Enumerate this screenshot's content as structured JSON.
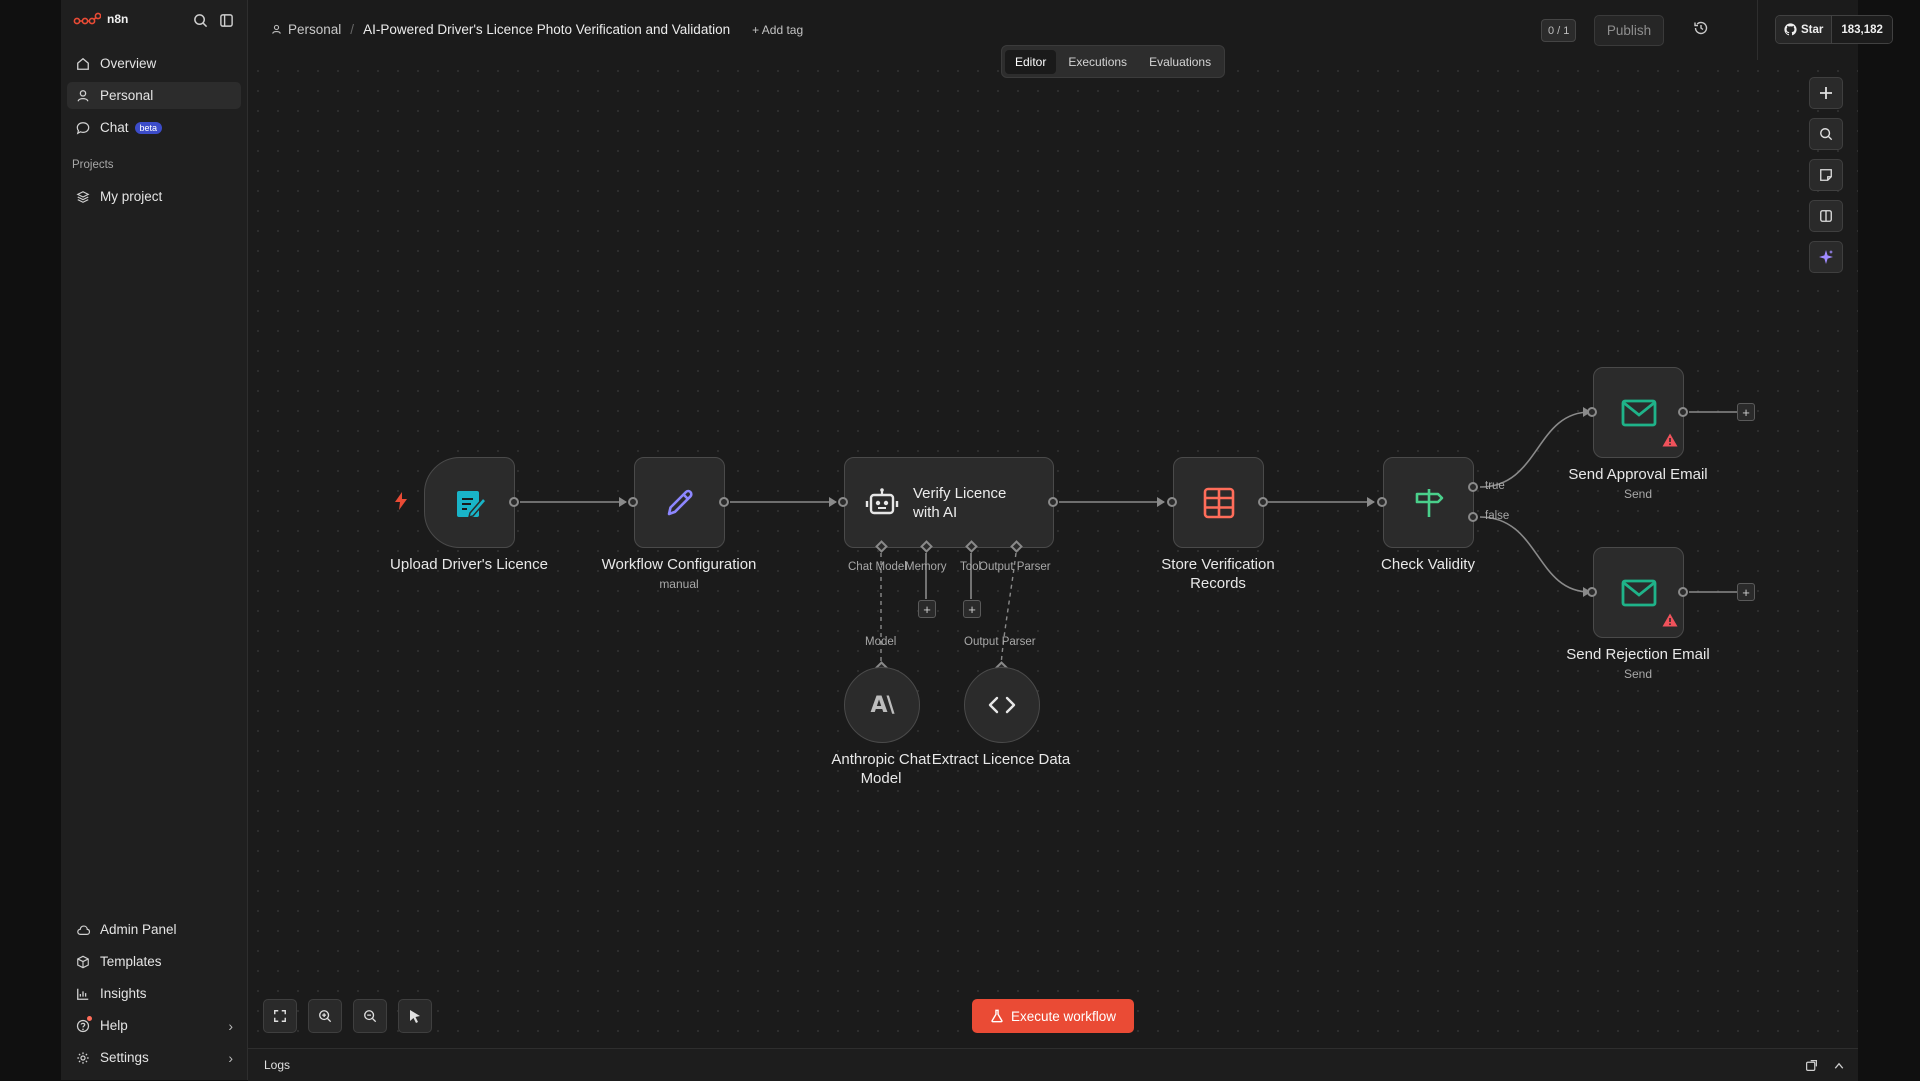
{
  "app": {
    "name": "n8n"
  },
  "sidebar": {
    "items": [
      {
        "label": "Overview",
        "icon": "home-icon"
      },
      {
        "label": "Personal",
        "icon": "user-icon"
      },
      {
        "label": "Chat",
        "icon": "chat-icon",
        "badge": "beta"
      }
    ],
    "projects_label": "Projects",
    "projects": [
      {
        "label": "My project",
        "icon": "layers-icon"
      }
    ],
    "bottom_items": [
      {
        "label": "Admin Panel",
        "icon": "cloud-icon"
      },
      {
        "label": "Templates",
        "icon": "box-icon"
      },
      {
        "label": "Insights",
        "icon": "chart-icon"
      },
      {
        "label": "Help",
        "icon": "help-icon"
      },
      {
        "label": "Settings",
        "icon": "gear-icon"
      }
    ]
  },
  "header": {
    "breadcrumb_project": "Personal",
    "breadcrumb_sep": "/",
    "workflow_name": "AI-Powered Driver's Licence Photo Verification and Validation",
    "add_tag": "+ Add tag",
    "counter": "0 / 1",
    "publish": "Publish",
    "github_star": "Star",
    "github_count": "183,182",
    "tabs": [
      "Editor",
      "Executions",
      "Evaluations"
    ]
  },
  "nodes": {
    "upload": {
      "label": "Upload Driver's Licence"
    },
    "config": {
      "label": "Workflow Configuration",
      "sub": "manual"
    },
    "verify": {
      "label_line1": "Verify Licence",
      "label_line2": "with AI"
    },
    "store": {
      "label_line1": "Store Verification",
      "label_line2": "Records"
    },
    "check": {
      "label": "Check Validity"
    },
    "approval": {
      "label": "Send Approval Email",
      "sub": "Send"
    },
    "rejection": {
      "label": "Send Rejection Email",
      "sub": "Send"
    },
    "anthropic": {
      "label_line1": "Anthropic Chat",
      "label_line2": "Model"
    },
    "extract": {
      "label": "Extract Licence Data"
    }
  },
  "sub_ports": {
    "chat_model": "Chat Model",
    "memory": "Memory",
    "tool": "Tool",
    "output_parser": "Output Parser",
    "model": "Model",
    "output_parser_2": "Output Parser"
  },
  "branches": {
    "true": "true",
    "false": "false"
  },
  "canvas": {
    "execute_button": "Execute workflow"
  },
  "logs": {
    "label": "Logs"
  },
  "colors": {
    "accent": "#ea4b35",
    "email": "#1fb389",
    "form": "#19b4c8",
    "edit": "#8d87ff",
    "table": "#ff6d5a",
    "check": "#4ad08b"
  }
}
